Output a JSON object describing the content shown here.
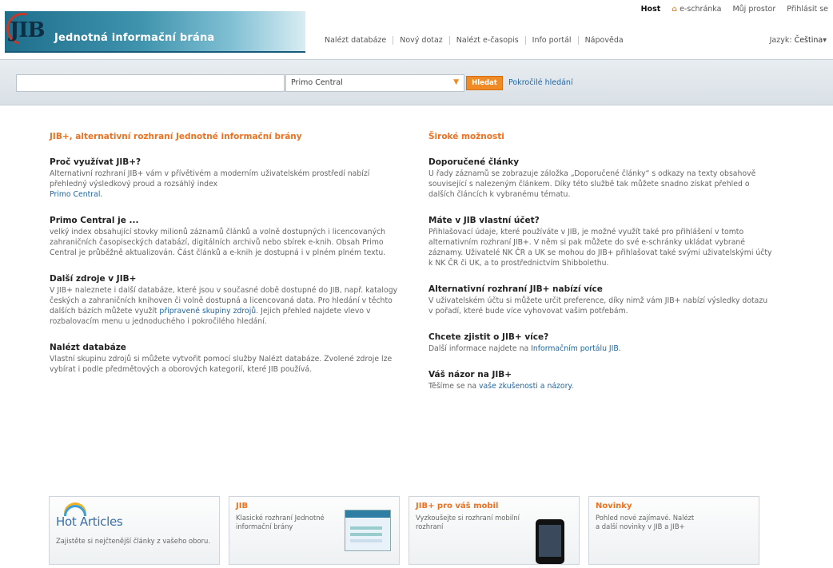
{
  "header": {
    "logo_text": "JIB",
    "logo_name": "Jednotná informační brána",
    "topbar": {
      "home": "Host",
      "eshelf": "e-schránka",
      "my_profile": "Můj prostor",
      "login": "Přihlásit se"
    },
    "nav": [
      "Nalézt databáze",
      "Nový dotaz",
      "Nalézt e-časopis",
      "Info portál",
      "Nápověda"
    ],
    "language_label": "Jazyk:",
    "language_value": "Čeština"
  },
  "search": {
    "input_value": "",
    "scope_selected": "Primo Central",
    "button_label": "Hledat",
    "advanced_link": "Pokročilé hledání"
  },
  "left_column": {
    "title": "JIB+, alternativní rozhraní Jednotné informační brány",
    "sections": [
      {
        "heading": "Proč využívat JIB+?",
        "text": "Alternativní rozhraní JIB+ vám v přívětivém a moderním uživatelském prostředí nabízí přehledný výsledkový proud a rozsáhlý index",
        "link": "Primo Central."
      },
      {
        "heading": "Primo Central je ...",
        "text": "velký index obsahující stovky milionů záznamů článků a volně dostupných i licencovaných zahraničních časopiseckých databází, digitálních archivů nebo sbírek e-knih. Obsah Primo Central je průběžně aktualizován. Část článků a e-knih je dostupná i v plném plném textu."
      },
      {
        "heading": "Další zdroje v JIB+",
        "text_before": "V JIB+ naleznete i další databáze, které jsou v současné době dostupné do JIB, např. katalogy českých a zahraničních knihoven či volně dostupná a licencovaná data. Pro hledání v těchto dalších bázích můžete využít ",
        "link": "připravené skupiny zdrojů",
        "text_after": ". Jejich přehled najdete vlevo v rozbalovacím menu u jednoduchého i pokročilého hledání."
      },
      {
        "heading": "Nalézt databáze",
        "text": "Vlastní skupinu zdrojů si můžete vytvořit pomocí služby Nalézt databáze. Zvolené zdroje lze vybírat i podle předmětových a oborových kategorií, které JIB používá."
      }
    ]
  },
  "right_column": {
    "title": "Široké možnosti",
    "sections": [
      {
        "heading": "Doporučené články",
        "text": "U řady záznamů se zobrazuje záložka „Doporučené články“ s odkazy na texty obsahově související s nalezeným článkem. Díky této službě tak můžete snadno získat přehled o dalších článcích k vybranému tématu."
      },
      {
        "heading": "Máte v JIB vlastní účet?",
        "text": "Přihlašovací údaje, které používáte v JIB, je možné využít také pro přihlášení v tomto alternativním rozhraní JIB+. V něm si pak můžete do své e-schránky ukládat vybrané záznamy. Uživatelé NK ČR a UK se mohou do JIB+ přihlašovat také svými uživatelskými účty k NK ČR či UK, a to prostřednictvím Shibbolethu."
      },
      {
        "heading": "Alternativní rozhraní JIB+ nabízí více",
        "text": "V uživatelském účtu si můžete určit preference, díky nimž vám JIB+ nabízí výsledky dotazu v pořadí, které bude více vyhovovat vašim potřebám."
      },
      {
        "heading": "Chcete zjistit o JIB+ více?",
        "text_before": "Další informace najdete na ",
        "link": "Informačním portálu JIB",
        "text_after": "."
      },
      {
        "heading": "Váš názor na JIB+",
        "text_before": "Těšíme se na ",
        "link": "vaše zkušenosti a názory",
        "text_after": "."
      }
    ]
  },
  "boxes": {
    "hot": {
      "title": "Hot Articles",
      "text": "Zajistěte si nejčtenější články z vašeho oboru."
    },
    "jib": {
      "title": "JIB",
      "text": "Klasické rozhraní Jednotné informační brány"
    },
    "mobile": {
      "title": "JIB+ pro váš mobil",
      "text": "Vyzkoušejte si rozhraní mobilní rozhraní"
    },
    "news": {
      "title": "Novinky",
      "text": "Pohled nové zajímavé. Nalézt a další novinky v JIB a JIB+"
    }
  },
  "colors": {
    "accent_orange": "#f07020",
    "link_blue": "#1f67a6",
    "logo_teal": "#1f6f8c"
  }
}
